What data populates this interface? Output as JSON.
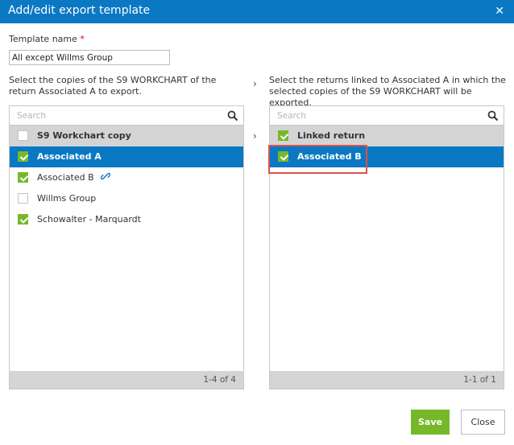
{
  "dialog": {
    "title": "Add/edit export template",
    "close_glyph": "✕"
  },
  "template_name": {
    "label": "Template name",
    "required_mark": "*",
    "value": "All except Willms Group"
  },
  "left": {
    "description": "Select the copies of the S9 WORKCHART of the return Associated A to export.",
    "search_placeholder": "Search",
    "header_label": "S9 Workchart copy",
    "header_checked": false,
    "items": [
      {
        "label": "Associated A",
        "checked": true,
        "selected": true,
        "linked": false
      },
      {
        "label": "Associated B",
        "checked": true,
        "selected": false,
        "linked": true
      },
      {
        "label": "Willms Group",
        "checked": false,
        "selected": false,
        "linked": false
      },
      {
        "label": "Schowalter - Marquardt",
        "checked": true,
        "selected": false,
        "linked": false
      }
    ],
    "pagination": "1-4 of 4"
  },
  "right": {
    "description": "Select the returns linked to Associated A in which the selected copies of the S9 WORKCHART will be exported.",
    "search_placeholder": "Search",
    "header_label": "Linked return",
    "header_checked": true,
    "items": [
      {
        "label": "Associated B",
        "checked": true,
        "selected": true
      }
    ],
    "pagination": "1-1 of 1"
  },
  "arrow_glyph": "›",
  "buttons": {
    "save": "Save",
    "close": "Close"
  },
  "icons": {
    "search": "magnifier-icon",
    "link": "link-icon",
    "close": "close-icon"
  },
  "colors": {
    "accent": "#0a78c2",
    "check": "#76b82a",
    "header_bg": "#d4d4d4",
    "highlight": "#d9534f"
  }
}
